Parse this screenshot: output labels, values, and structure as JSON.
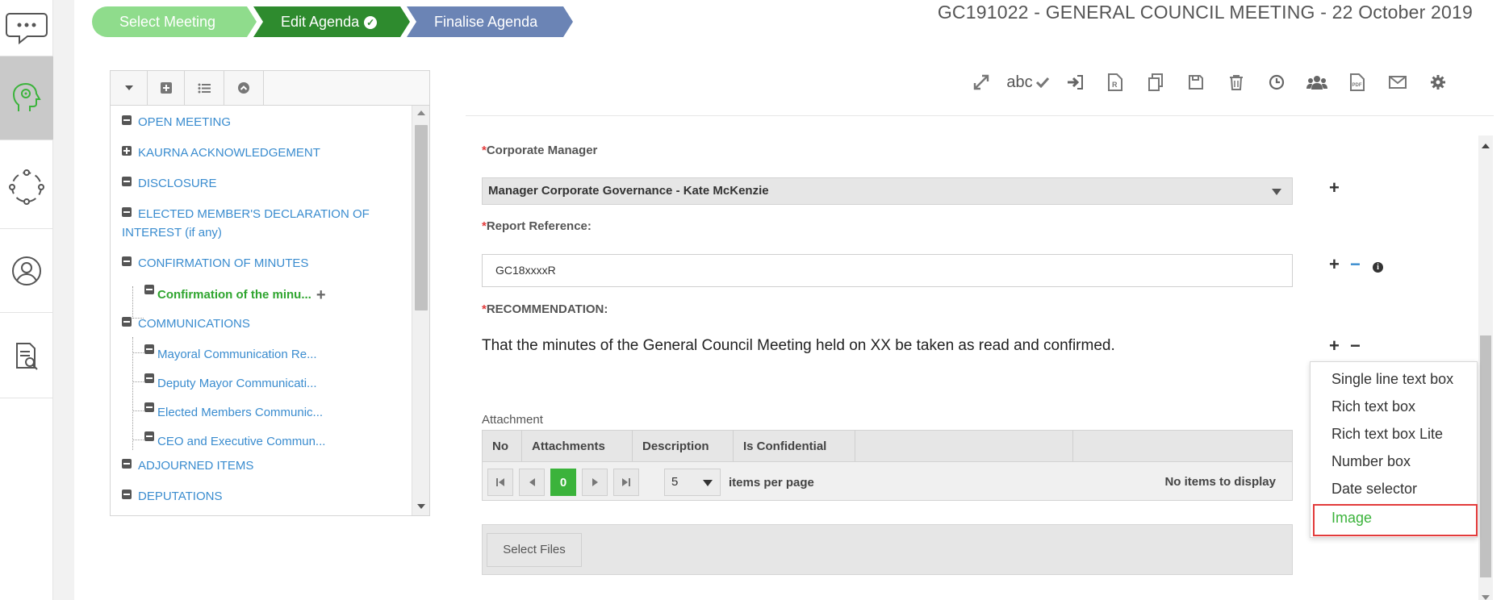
{
  "steps": [
    {
      "label": "Select Meeting"
    },
    {
      "label": "Edit Agenda"
    },
    {
      "label": "Finalise Agenda"
    }
  ],
  "meeting_title": "GC191022 - GENERAL COUNCIL MEETING - 22 October 2019",
  "toolbar": {
    "spell_label": "abc"
  },
  "tree": {
    "nodes": [
      {
        "label": "OPEN MEETING"
      },
      {
        "label": "KAURNA ACKNOWLEDGEMENT"
      },
      {
        "label": "DISCLOSURE"
      },
      {
        "label": "ELECTED MEMBER'S DECLARATION OF"
      },
      {
        "label": "INTEREST (if any)"
      },
      {
        "label": "CONFIRMATION OF MINUTES"
      },
      {
        "label": "COMMUNICATIONS"
      },
      {
        "label": "ADJOURNED ITEMS"
      },
      {
        "label": "DEPUTATIONS"
      }
    ],
    "children": [
      {
        "label": "Confirmation of the minu..."
      },
      {
        "label": "Mayoral Communication Re..."
      },
      {
        "label": "Deputy Mayor Communicati..."
      },
      {
        "label": "Elected Members Communic..."
      },
      {
        "label": "CEO and Executive Commun..."
      }
    ]
  },
  "form": {
    "required_mark": "*",
    "corporate_manager_label": "Corporate Manager",
    "corporate_manager_value": "Manager Corporate Governance - Kate McKenzie",
    "report_reference_label": "Report Reference:",
    "report_reference_value": "GC18xxxxR",
    "recommendation_label": "RECOMMENDATION:",
    "recommendation_text": "That the minutes of the General Council Meeting held on XX be taken as read and confirmed."
  },
  "attachments": {
    "label": "Attachment",
    "columns": [
      "No",
      "Attachments",
      "Description",
      "Is Confidential"
    ],
    "current_page": "0",
    "page_size": "5",
    "items_per_page_label": "items per page",
    "empty_text": "No items to display",
    "select_files_label": "Select Files"
  },
  "add_menu": {
    "items": [
      {
        "label": "Single line text box"
      },
      {
        "label": "Rich text box"
      },
      {
        "label": "Rich text box Lite"
      },
      {
        "label": "Number box"
      },
      {
        "label": "Date selector"
      },
      {
        "label": "Image"
      }
    ],
    "highlighted": "Image"
  },
  "colors": {
    "step_done": "#8fdc8c",
    "step_current": "#2e8b2e",
    "step_next": "#6b84b5",
    "link": "#3a8ccf",
    "active_green": "#2fa52f",
    "highlight_box": "#e23b3b"
  }
}
